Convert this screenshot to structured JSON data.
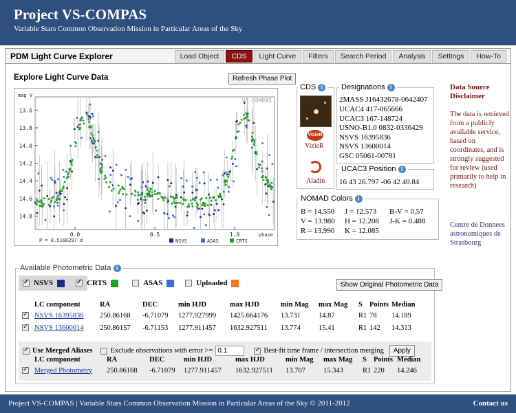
{
  "banner": {
    "title": "Project VS-COMPAS",
    "subtitle": "Variable Stars Common Observation Mission in Particular Areas of the Sky"
  },
  "app": {
    "title": "PDM Light Curve Explorer",
    "tabs": [
      "Load Object",
      "CDS",
      "Light Curve",
      "Filters",
      "Search Period",
      "Analysis",
      "Settings",
      "How-To"
    ],
    "active_tab": "CDS"
  },
  "explore": {
    "title": "Explore Light Curve Data",
    "refresh_label": "Refresh Phase Plot"
  },
  "chart_data": {
    "type": "scatter",
    "ylabel": "mag V",
    "watermark": "VS-COMPAS",
    "period_label": "P = 0.5166297 d",
    "xlabel": "phase",
    "x_ticks": [
      "0.0",
      "0.5",
      "1.0"
    ],
    "y_ticks": [
      "13.6",
      "13.8",
      "14.0",
      "14.2",
      "14.4",
      "14.6",
      "14.8"
    ],
    "ylim": [
      13.45,
      14.95
    ],
    "xlim": [
      -0.25,
      1.25
    ],
    "legend": [
      "NSVS",
      "ASAS",
      "CRTS"
    ],
    "colors": {
      "NSVS": "#1b2a8a",
      "ASAS": "#3a6fe0",
      "CRTS": "#22a022"
    }
  },
  "cds": {
    "label": "CDS",
    "vizier": "VizieR",
    "aladin": "Aladin"
  },
  "designations": {
    "label": "Designations",
    "items": [
      "2MASS J16432678-0642407",
      "UCAC4 417-065666",
      "UCAC3 167-148724",
      "USNO-B1.0 0832-0336429",
      "NSVS 16395836",
      "NSVS 13600014",
      "GSC 05061-00781"
    ]
  },
  "position": {
    "label": "UCAC3 Position",
    "value": "16 43 26.797 -06 42 40.84"
  },
  "nomad": {
    "label": "NOMAD Colors",
    "b": "B = 14.550",
    "v": "V = 13.980",
    "r": "R = 13.990",
    "j": "J = 12.573",
    "h": "H = 12.208",
    "k": "K = 12.085",
    "bv": "B-V = 0.57",
    "jk": "J-K = 0.488"
  },
  "side": {
    "title": "Data Source Disclaimer",
    "text": "The data is retrieved from a publicly available service, based on coordinates, and is strongly suggested for review (used primarily to help in research)",
    "link": "Centre de Donnees astronomiques de Strasbourg"
  },
  "photometric": {
    "label": "Available Photometric Data",
    "nsvs": "NSVS",
    "crts": "CRTS",
    "asas": "ASAS",
    "uploaded": "Uploaded",
    "show_btn": "Show Original Photometric Data"
  },
  "table1": {
    "headers": [
      "LC component",
      "RA",
      "DEC",
      "min HJD",
      "max HJD",
      "min Mag",
      "max Mag",
      "S",
      "Points",
      "Median"
    ],
    "rows": [
      [
        "NSVS 16395836",
        "250.86168",
        "-6.71079",
        "1277.927999",
        "1425.664176",
        "13.731",
        "14.87",
        "R1",
        "78",
        "14.189"
      ],
      [
        "NSVS 13600014",
        "250.86157",
        "-6.71153",
        "1277.911457",
        "1632.927511",
        "13.774",
        "15.41",
        "R1",
        "142",
        "14.313"
      ]
    ]
  },
  "merge": {
    "use_label": "Use Merged Aliases",
    "exclude_label": "Exclude observations with error >=",
    "exclude_value": "0.1",
    "bestfit_label": "Best-fit time frame / intersection merging",
    "apply_label": "Apply"
  },
  "table2": {
    "headers": [
      "LC component",
      "RA",
      "DEC",
      "min HJD",
      "max HJD",
      "min Mag",
      "max Mag",
      "S",
      "Points",
      "Median"
    ],
    "row": [
      "Merged Photometry",
      "250.86168",
      "-6.71079",
      "1277.911457",
      "1632.927511",
      "13.707",
      "15.343",
      "R1",
      "220",
      "14.246"
    ]
  },
  "footer": {
    "left": "Project VS-COMPAS | Variable Stars Common Observation Mission in Particular Areas of the Sky © 2011-2012",
    "right": "Contact us"
  }
}
